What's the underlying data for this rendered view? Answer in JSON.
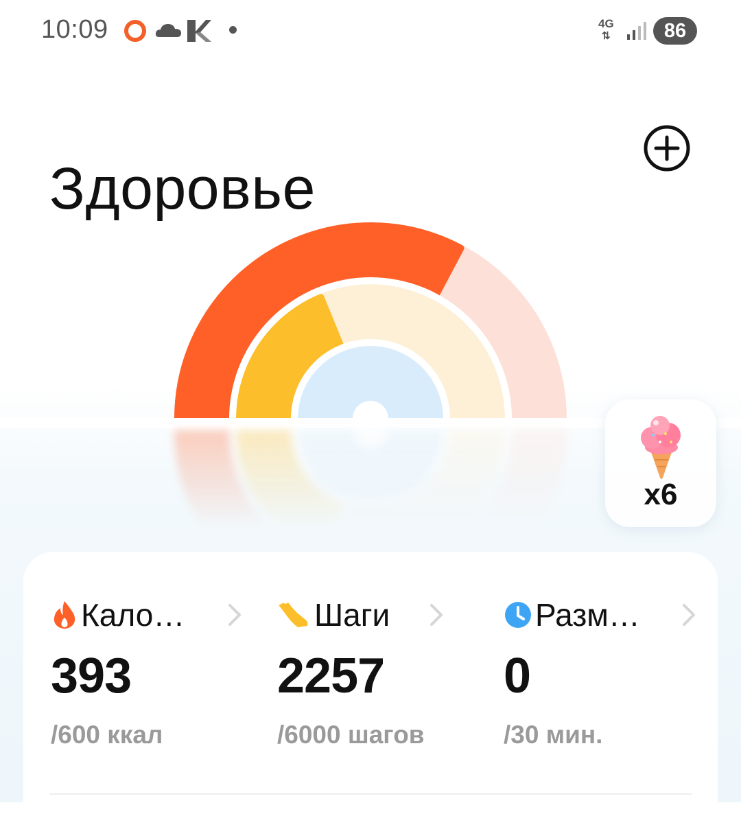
{
  "status_bar": {
    "time": "10:09",
    "network_label_top": "4G",
    "battery": "86"
  },
  "header": {
    "title": "Здоровье",
    "add_icon": "plus-circle-icon"
  },
  "activity_rings": {
    "calories_progress": 0.655,
    "steps_progress": 0.376,
    "minutes_progress": 0,
    "colors": {
      "calories": "#fe6028",
      "calories_track": "#fde0d8",
      "steps": "#fdbe2c",
      "steps_track": "#fdf0d6",
      "minutes": "#d9ecfc"
    }
  },
  "reward": {
    "icon": "ice-cream-icon",
    "count": "x6"
  },
  "stats": [
    {
      "icon": "flame-icon",
      "label": "Кало…",
      "value": "393",
      "goal": "/600 ккал"
    },
    {
      "icon": "shoe-icon",
      "label": "Шаги",
      "value": "2257",
      "goal": "/6000 шагов"
    },
    {
      "icon": "clock-icon",
      "label": "Разм…",
      "value": "0",
      "goal": "/30 мин."
    }
  ]
}
